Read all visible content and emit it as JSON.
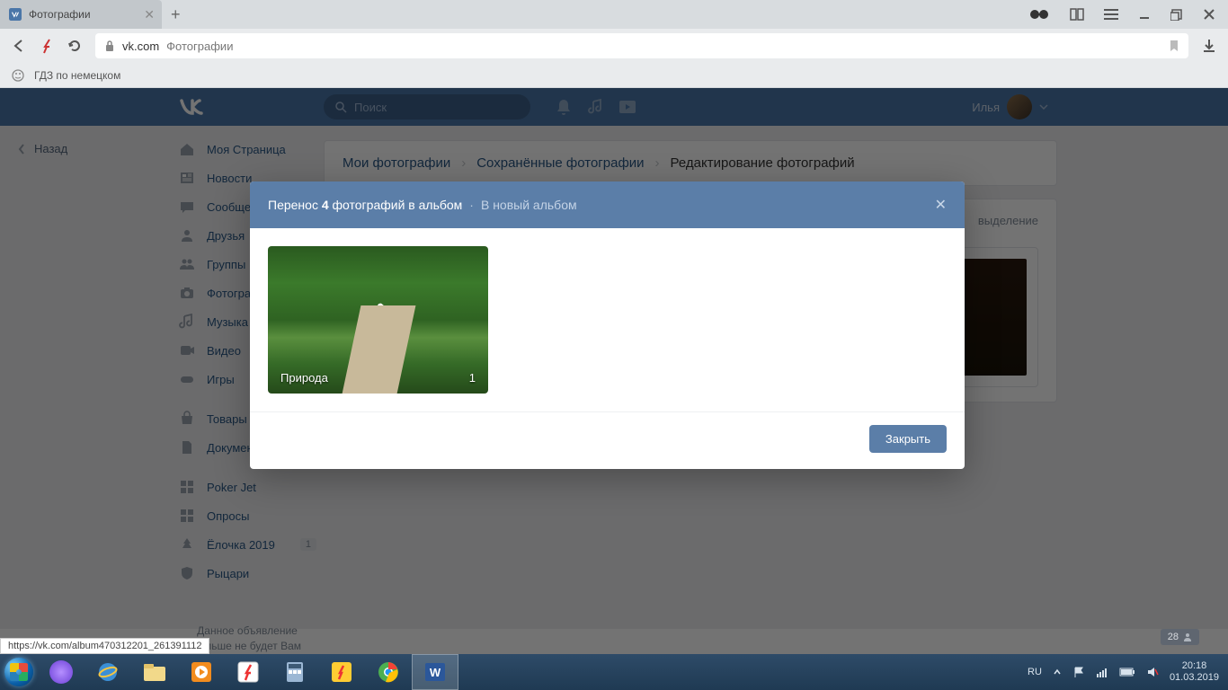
{
  "browser": {
    "tab_title": "Фотографии",
    "domain": "vk.com",
    "page_title": "Фотографии",
    "bookmark": "ГДЗ по немецком"
  },
  "vk": {
    "search_placeholder": "Поиск",
    "username": "Илья",
    "back": "Назад",
    "sidebar": {
      "my_page": "Моя Страница",
      "news": "Новости",
      "messages": "Сообщения",
      "friends": "Друзья",
      "groups": "Группы",
      "photos": "Фотографии",
      "music": "Музыка",
      "videos": "Видео",
      "games": "Игры",
      "market": "Товары",
      "docs": "Документы",
      "poker": "Poker Jet",
      "polls": "Опросы",
      "elka": "Ёлочка 2019",
      "elka_badge": "1",
      "knights": "Рыцари"
    },
    "ad_text": "Данное объявление больше не будет Вам",
    "breadcrumb": {
      "my_photos": "Мои фотографии",
      "saved": "Сохранённые фотографии",
      "edit": "Редактирование фотографий"
    },
    "deselect": "выделение"
  },
  "modal": {
    "title_pre": "Перенос ",
    "title_count": "4",
    "title_post": " фотографий в альбом",
    "new_album": "В новый альбом",
    "album_name": "Природа",
    "album_count": "1",
    "close_btn": "Закрыть"
  },
  "status_url": "https://vk.com/album470312201_261391112",
  "notif_count": "28",
  "tray": {
    "lang": "RU",
    "time": "20:18",
    "date": "01.03.2019"
  }
}
